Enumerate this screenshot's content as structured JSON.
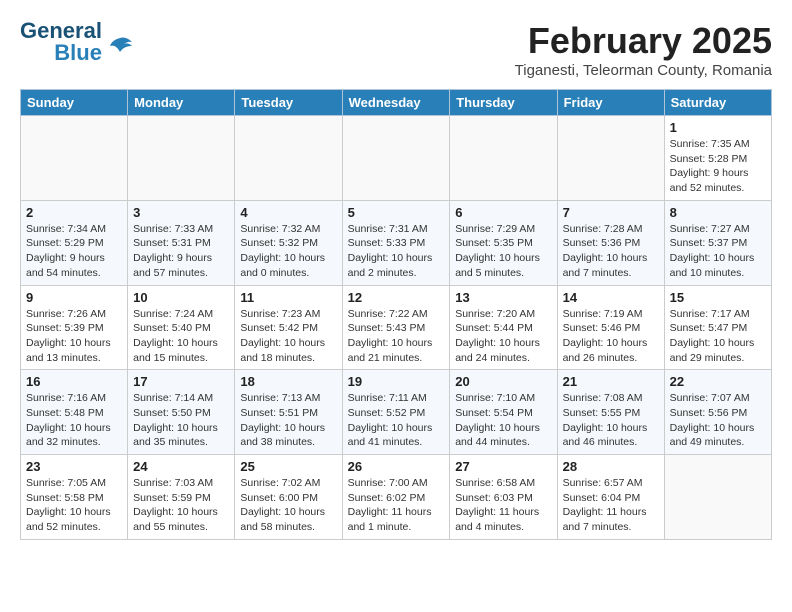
{
  "header": {
    "logo": {
      "general": "General",
      "blue": "Blue"
    },
    "title": "February 2025",
    "location": "Tiganesti, Teleorman County, Romania"
  },
  "weekdays": [
    "Sunday",
    "Monday",
    "Tuesday",
    "Wednesday",
    "Thursday",
    "Friday",
    "Saturday"
  ],
  "weeks": [
    {
      "days": [
        {
          "num": "",
          "info": ""
        },
        {
          "num": "",
          "info": ""
        },
        {
          "num": "",
          "info": ""
        },
        {
          "num": "",
          "info": ""
        },
        {
          "num": "",
          "info": ""
        },
        {
          "num": "",
          "info": ""
        },
        {
          "num": "1",
          "info": "Sunrise: 7:35 AM\nSunset: 5:28 PM\nDaylight: 9 hours and 52 minutes."
        }
      ]
    },
    {
      "days": [
        {
          "num": "2",
          "info": "Sunrise: 7:34 AM\nSunset: 5:29 PM\nDaylight: 9 hours and 54 minutes."
        },
        {
          "num": "3",
          "info": "Sunrise: 7:33 AM\nSunset: 5:31 PM\nDaylight: 9 hours and 57 minutes."
        },
        {
          "num": "4",
          "info": "Sunrise: 7:32 AM\nSunset: 5:32 PM\nDaylight: 10 hours and 0 minutes."
        },
        {
          "num": "5",
          "info": "Sunrise: 7:31 AM\nSunset: 5:33 PM\nDaylight: 10 hours and 2 minutes."
        },
        {
          "num": "6",
          "info": "Sunrise: 7:29 AM\nSunset: 5:35 PM\nDaylight: 10 hours and 5 minutes."
        },
        {
          "num": "7",
          "info": "Sunrise: 7:28 AM\nSunset: 5:36 PM\nDaylight: 10 hours and 7 minutes."
        },
        {
          "num": "8",
          "info": "Sunrise: 7:27 AM\nSunset: 5:37 PM\nDaylight: 10 hours and 10 minutes."
        }
      ]
    },
    {
      "days": [
        {
          "num": "9",
          "info": "Sunrise: 7:26 AM\nSunset: 5:39 PM\nDaylight: 10 hours and 13 minutes."
        },
        {
          "num": "10",
          "info": "Sunrise: 7:24 AM\nSunset: 5:40 PM\nDaylight: 10 hours and 15 minutes."
        },
        {
          "num": "11",
          "info": "Sunrise: 7:23 AM\nSunset: 5:42 PM\nDaylight: 10 hours and 18 minutes."
        },
        {
          "num": "12",
          "info": "Sunrise: 7:22 AM\nSunset: 5:43 PM\nDaylight: 10 hours and 21 minutes."
        },
        {
          "num": "13",
          "info": "Sunrise: 7:20 AM\nSunset: 5:44 PM\nDaylight: 10 hours and 24 minutes."
        },
        {
          "num": "14",
          "info": "Sunrise: 7:19 AM\nSunset: 5:46 PM\nDaylight: 10 hours and 26 minutes."
        },
        {
          "num": "15",
          "info": "Sunrise: 7:17 AM\nSunset: 5:47 PM\nDaylight: 10 hours and 29 minutes."
        }
      ]
    },
    {
      "days": [
        {
          "num": "16",
          "info": "Sunrise: 7:16 AM\nSunset: 5:48 PM\nDaylight: 10 hours and 32 minutes."
        },
        {
          "num": "17",
          "info": "Sunrise: 7:14 AM\nSunset: 5:50 PM\nDaylight: 10 hours and 35 minutes."
        },
        {
          "num": "18",
          "info": "Sunrise: 7:13 AM\nSunset: 5:51 PM\nDaylight: 10 hours and 38 minutes."
        },
        {
          "num": "19",
          "info": "Sunrise: 7:11 AM\nSunset: 5:52 PM\nDaylight: 10 hours and 41 minutes."
        },
        {
          "num": "20",
          "info": "Sunrise: 7:10 AM\nSunset: 5:54 PM\nDaylight: 10 hours and 44 minutes."
        },
        {
          "num": "21",
          "info": "Sunrise: 7:08 AM\nSunset: 5:55 PM\nDaylight: 10 hours and 46 minutes."
        },
        {
          "num": "22",
          "info": "Sunrise: 7:07 AM\nSunset: 5:56 PM\nDaylight: 10 hours and 49 minutes."
        }
      ]
    },
    {
      "days": [
        {
          "num": "23",
          "info": "Sunrise: 7:05 AM\nSunset: 5:58 PM\nDaylight: 10 hours and 52 minutes."
        },
        {
          "num": "24",
          "info": "Sunrise: 7:03 AM\nSunset: 5:59 PM\nDaylight: 10 hours and 55 minutes."
        },
        {
          "num": "25",
          "info": "Sunrise: 7:02 AM\nSunset: 6:00 PM\nDaylight: 10 hours and 58 minutes."
        },
        {
          "num": "26",
          "info": "Sunrise: 7:00 AM\nSunset: 6:02 PM\nDaylight: 11 hours and 1 minute."
        },
        {
          "num": "27",
          "info": "Sunrise: 6:58 AM\nSunset: 6:03 PM\nDaylight: 11 hours and 4 minutes."
        },
        {
          "num": "28",
          "info": "Sunrise: 6:57 AM\nSunset: 6:04 PM\nDaylight: 11 hours and 7 minutes."
        },
        {
          "num": "",
          "info": ""
        }
      ]
    }
  ]
}
